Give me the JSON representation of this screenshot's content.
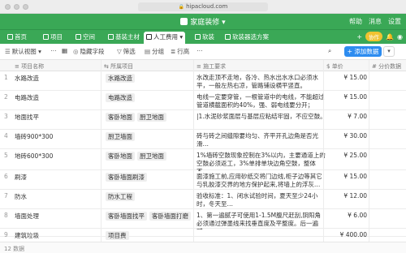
{
  "browser": {
    "url": "hipacloud.com"
  },
  "app": {
    "title": "家庭装修",
    "right": [
      "帮助",
      "消息",
      "设置"
    ]
  },
  "tabs": [
    {
      "label": "首页"
    },
    {
      "label": "项目"
    },
    {
      "label": "空间"
    },
    {
      "label": "基装主材"
    },
    {
      "label": "人工费用"
    },
    {
      "label": "软装"
    },
    {
      "label": "软装器选方案"
    }
  ],
  "tabbar_right": {
    "pill": "协作"
  },
  "toolbar": {
    "view": "默认视图",
    "hide_fields": "隐藏字段",
    "filter": "筛选",
    "group": "分组",
    "row_height": "行高",
    "add_button": "添加数据",
    "caret": "▾"
  },
  "columns": [
    "项目名称",
    "所属项目",
    "施工要求",
    "单价",
    "分价数据"
  ],
  "rows": [
    {
      "no": "1",
      "name": "水路改造",
      "tags": [
        "水路改造"
      ],
      "desc": "水改走顶不走地，各冷、热水出水水口必须水平，一般左热右凉，管路铺设横平竖直。",
      "price": "¥ 15.00"
    },
    {
      "no": "2",
      "name": "电路改造",
      "tags": [
        "电路改造"
      ],
      "desc": "电线一定要穿管，一根管道中的电线，不能超过管道横截面积的40%，强、弱电线要分开；",
      "price": "¥ 15.00"
    },
    {
      "no": "3",
      "name": "地面找平",
      "tags": [
        "客卧地面",
        "厨卫地面"
      ],
      "desc": "|1.水泥砂浆面层与基层应粘结牢固，不应空鼓。",
      "price": "¥ 7.00"
    },
    {
      "no": "4",
      "name": "墙砖900*300",
      "tags": [
        "厨卫墙面"
      ],
      "desc": "砖与砖之间缝隙要均匀、齐平开孔边角是否光滑…",
      "price": "¥ 30.00"
    },
    {
      "no": "5",
      "name": "地砖600*300",
      "tags": [
        "客卧地面",
        "厨卫地面"
      ],
      "desc": "1%墙砖空鼓现象控制在3%以内，主要通道上的空鼓必须返工，3%单排单块边角空鼓，整体不…",
      "price": "¥ 25.00"
    },
    {
      "no": "6",
      "name": "刷漆",
      "tags": [
        "客卧墙面刷漆"
      ],
      "desc": "面漆施工前,应用砂纸交将门边线,柜子边等其它与乳胶漆交界的地方保护起来,将墙上的浮灰…",
      "price": "¥ 15.00"
    },
    {
      "no": "7",
      "name": "防水",
      "tags": [
        "防水工程"
      ],
      "desc": "验收标准：1、闭水试验时间，夏天至少24小时，冬天至…",
      "price": "¥ 12.00"
    },
    {
      "no": "8",
      "name": "墙面处理",
      "tags": [
        "客卧墙面找平",
        "客卧墙面打磨"
      ],
      "desc": "1、第一遍腻子可使用1-1.5M腹尺赶刮,阴阳角必须通过弹墨线来找垂直度及平整度。后一遍腻…",
      "price": "¥ 6.00"
    },
    {
      "no": "9",
      "name": "建筑垃圾",
      "tags": [
        "项目费"
      ],
      "desc": "",
      "price": "¥ 400.00"
    }
  ],
  "footer": {
    "count": "12 数据"
  }
}
